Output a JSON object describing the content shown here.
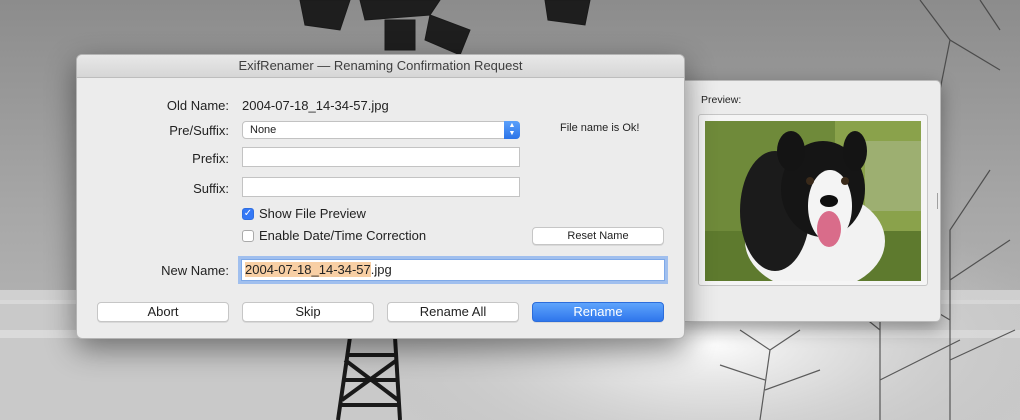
{
  "dialog": {
    "title": "ExifRenamer  —  Renaming Confirmation Request",
    "old_name_label": "Old Name:",
    "old_name_value": "2004-07-18_14-34-57.jpg",
    "presuffix_label": "Pre/Suffix:",
    "presuffix_selected": "None",
    "status_text": "File name is Ok!",
    "prefix_label": "Prefix:",
    "prefix_value": "",
    "suffix_label": "Suffix:",
    "suffix_value": "",
    "show_preview_label": "Show File Preview",
    "show_preview_checked": true,
    "datetime_label": "Enable Date/Time Correction",
    "datetime_checked": false,
    "reset_button": "Reset Name",
    "new_name_label": "New Name:",
    "new_name_selected_part": "2004-07-18_14-34-57",
    "new_name_rest": ".jpg",
    "buttons": {
      "abort": "Abort",
      "skip": "Skip",
      "rename_all": "Rename All",
      "rename": "Rename"
    }
  },
  "preview": {
    "label": "Preview:"
  },
  "icons": {
    "checkmark": "checkmark-icon",
    "select_arrows": "up-down-chevron-icon"
  },
  "colors": {
    "accent": "#3478f6",
    "selection_highlight": "#f8cfa4",
    "dialog_bg": "#ececec"
  }
}
